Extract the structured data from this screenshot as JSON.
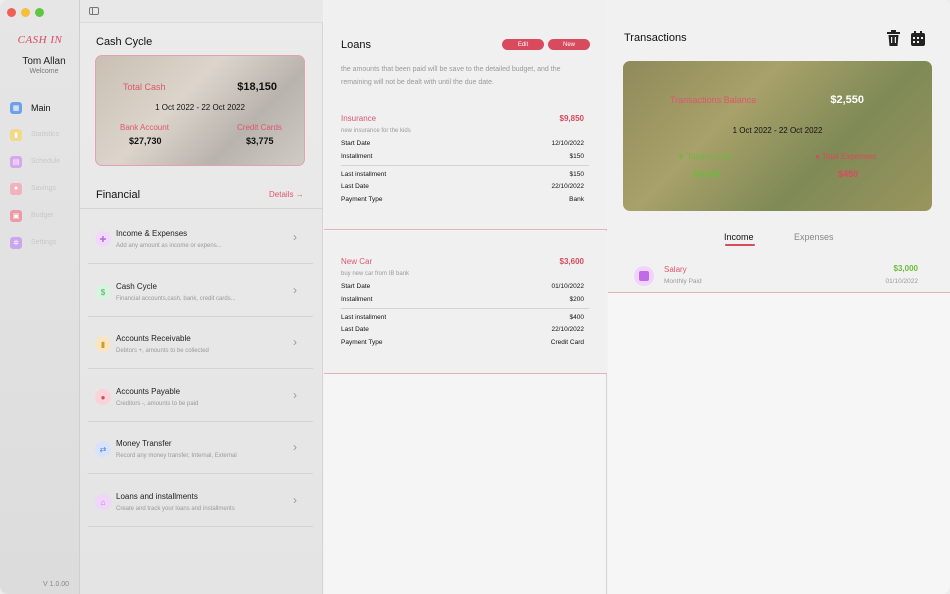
{
  "app": {
    "logo": "CASH IN",
    "user_name": "Tom Allan",
    "welcome": "Welcome",
    "version": "V 1.0.00"
  },
  "sidebar": {
    "items": [
      {
        "label": "Main",
        "icon": "grid-icon",
        "active": true
      },
      {
        "label": "Statistics",
        "icon": "chart-icon",
        "active": false
      },
      {
        "label": "Schedule",
        "icon": "calendar-icon",
        "active": false
      },
      {
        "label": "Savings",
        "icon": "piggy-icon",
        "active": false
      },
      {
        "label": "Budget",
        "icon": "wallet-icon",
        "active": false
      },
      {
        "label": "Settings",
        "icon": "gear-icon",
        "active": false
      }
    ]
  },
  "cash_cycle": {
    "title": "Cash Cycle",
    "total_label": "Total Cash",
    "total_value": "$18,150",
    "date_range": "1 Oct 2022 - 22 Oct 2022",
    "bank_label": "Bank Account",
    "bank_value": "$27,730",
    "credit_label": "Credit Cards",
    "credit_value": "$3,775"
  },
  "financial": {
    "title": "Financial",
    "details_label": "Details",
    "items": [
      {
        "title": "Income & Expenses",
        "sub": "Add any amount as income or expens...",
        "icon": "income-icon",
        "color": "#b86fe0"
      },
      {
        "title": "Cash Cycle",
        "sub": "Financial accounts,cash, bank, credit cards...",
        "icon": "cash-icon",
        "color": "#5ac27a"
      },
      {
        "title": "Accounts Receivable",
        "sub": "Debtors +, amounts to be collected",
        "icon": "receivable-icon",
        "color": "#e0a93a"
      },
      {
        "title": "Accounts Payable",
        "sub": "Creditors -, amounts to be paid",
        "icon": "payable-icon",
        "color": "#e0566d"
      },
      {
        "title": "Money Transfer",
        "sub": "Record any money transfer, Internal, External",
        "icon": "transfer-icon",
        "color": "#4a7de0"
      },
      {
        "title": "Loans and installments",
        "sub": "Create and track your loans and installments",
        "icon": "loans-icon",
        "color": "#b86fe0"
      }
    ]
  },
  "loans": {
    "title": "Loans",
    "edit_label": "Edit",
    "new_label": "New",
    "description": "the amounts that been paid will be save to the detailed budget, and the remaining will not be dealt with until the due date.",
    "items": [
      {
        "name": "Insurance",
        "amount": "$9,850",
        "note": "new insurance for the kids",
        "rows": [
          {
            "k": "Start Date",
            "v": "12/10/2022"
          },
          {
            "k": "Installment",
            "v": "$150"
          },
          {
            "k": "Last installment",
            "v": "$150"
          },
          {
            "k": "Last Date",
            "v": "22/10/2022"
          },
          {
            "k": "Payment Type",
            "v": "Bank"
          }
        ]
      },
      {
        "name": "New Car",
        "amount": "$3,600",
        "note": "buy new car from IB bank",
        "rows": [
          {
            "k": "Start Date",
            "v": "01/10/2022"
          },
          {
            "k": "Installment",
            "v": "$200"
          },
          {
            "k": "Last installment",
            "v": "$400"
          },
          {
            "k": "Last Date",
            "v": "22/10/2022"
          },
          {
            "k": "Payment Type",
            "v": "Credit Card"
          }
        ]
      }
    ]
  },
  "transactions": {
    "title": "Transactions",
    "balance_label": "Transactions Balance",
    "balance_value": "$2,550",
    "date_range": "1 Oct 2022 - 22 Oct 2022",
    "income_label": "Total Income",
    "income_value": "$3,000",
    "expense_label": "Total Expenses",
    "expense_value": "$450",
    "tabs": [
      "Income",
      "Expenses"
    ],
    "list": [
      {
        "title": "Salary",
        "sub": "Monthly Paid",
        "amount": "$3,000",
        "date": "01/10/2022"
      }
    ]
  },
  "colors": {
    "accent": "#d84a5e",
    "income": "#6dbb3c",
    "expense": "#d84a5e"
  }
}
